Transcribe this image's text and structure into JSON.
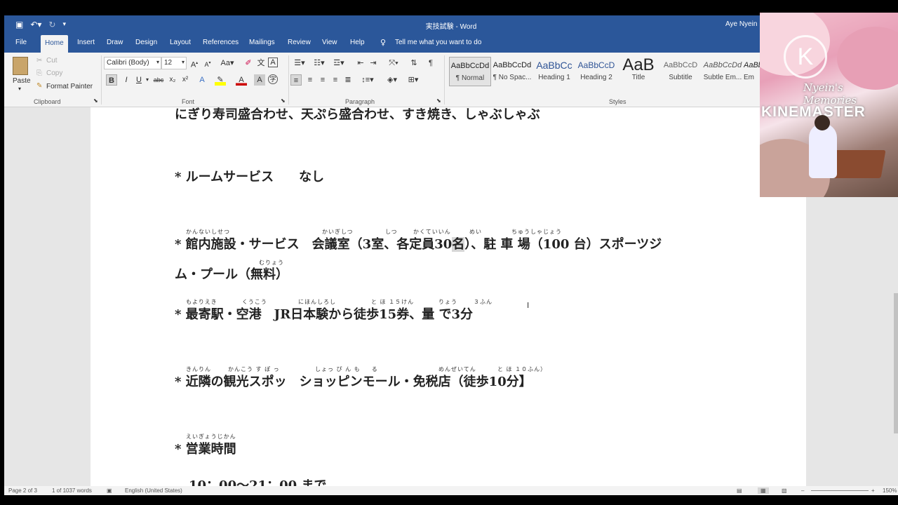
{
  "window": {
    "title": "実技試験  -  Word",
    "user": "Aye Nyein"
  },
  "tabs": [
    "File",
    "Home",
    "Insert",
    "Draw",
    "Design",
    "Layout",
    "References",
    "Mailings",
    "Review",
    "View",
    "Help"
  ],
  "tell_me": "Tell me what you want to do",
  "clipboard": {
    "paste": "Paste",
    "cut": "Cut",
    "copy": "Copy",
    "format_painter": "Format Painter",
    "label": "Clipboard"
  },
  "font": {
    "name": "Calibri (Body)",
    "size": "12",
    "label": "Font"
  },
  "paragraph": {
    "label": "Paragraph"
  },
  "styles": {
    "label": "Styles",
    "items": [
      {
        "preview": "AaBbCcDd",
        "name": "¶ Normal"
      },
      {
        "preview": "AaBbCcDd",
        "name": "¶ No Spac..."
      },
      {
        "preview": "AaBbCc",
        "name": "Heading 1"
      },
      {
        "preview": "AaBbCcD",
        "name": "Heading 2"
      },
      {
        "preview": "AaB",
        "name": "Title"
      },
      {
        "preview": "AaBbCcD",
        "name": "Subtitle"
      },
      {
        "preview": "AaBbCcDd",
        "name": "Subtle Em..."
      },
      {
        "preview": "AaBb",
        "name": "Em"
      }
    ]
  },
  "doc": {
    "line0": "にぎり寿司盛合わせ、天ぷら盛合わせ、すき焼き、しゃぶしゃぶ",
    "line1": "* ルームサービス　　なし",
    "line2a": "* 館内施設・サービス　会議室（3室、各定員30",
    "line2b": "名",
    "line2c": "）、駐 車 場（100 台）スポーツジ",
    "line3": "ム・プール（無料）",
    "line4": "* 最寄駅・空港　JR日本験から徒歩15券、量 で3分",
    "line5": "* 近隣の観光スポッ　ショッピンモール・免税店（徒歩10分】",
    "line6": "* 営業時間",
    "line7": "10：00～21：00 まで",
    "ruby": {
      "kannai": "かんないしせつ",
      "kaigi": "かいぎしつ",
      "shitsu": "しつ",
      "teiin": "かくていいん",
      "mei": "めい",
      "chusha": "ちゅうしゃじょう",
      "muryo": "むりょう",
      "moyori": "もよりえき",
      "kuko": "くうこう",
      "nihon": "にほんしろし",
      "toho": "と ほ １５けん",
      "ryo": "りょう",
      "fun": "３ふん",
      "kinrin": "きんりん",
      "kanko": "かんこう す ぽ っ",
      "shop": "しょっ ぴ ん も 　 る",
      "menzei": "めんぜいてん",
      "toho2": "と ほ １０ふん）",
      "eigyo": "えいぎょうじかん"
    }
  },
  "status": {
    "page": "Page 2 of 3",
    "words": "1 of 1037 words",
    "lang": "English (United States)",
    "zoom": "150%"
  },
  "overlay": {
    "brand": "KINEMASTER",
    "caption": "Nyein's Memories",
    "logo": "K"
  }
}
